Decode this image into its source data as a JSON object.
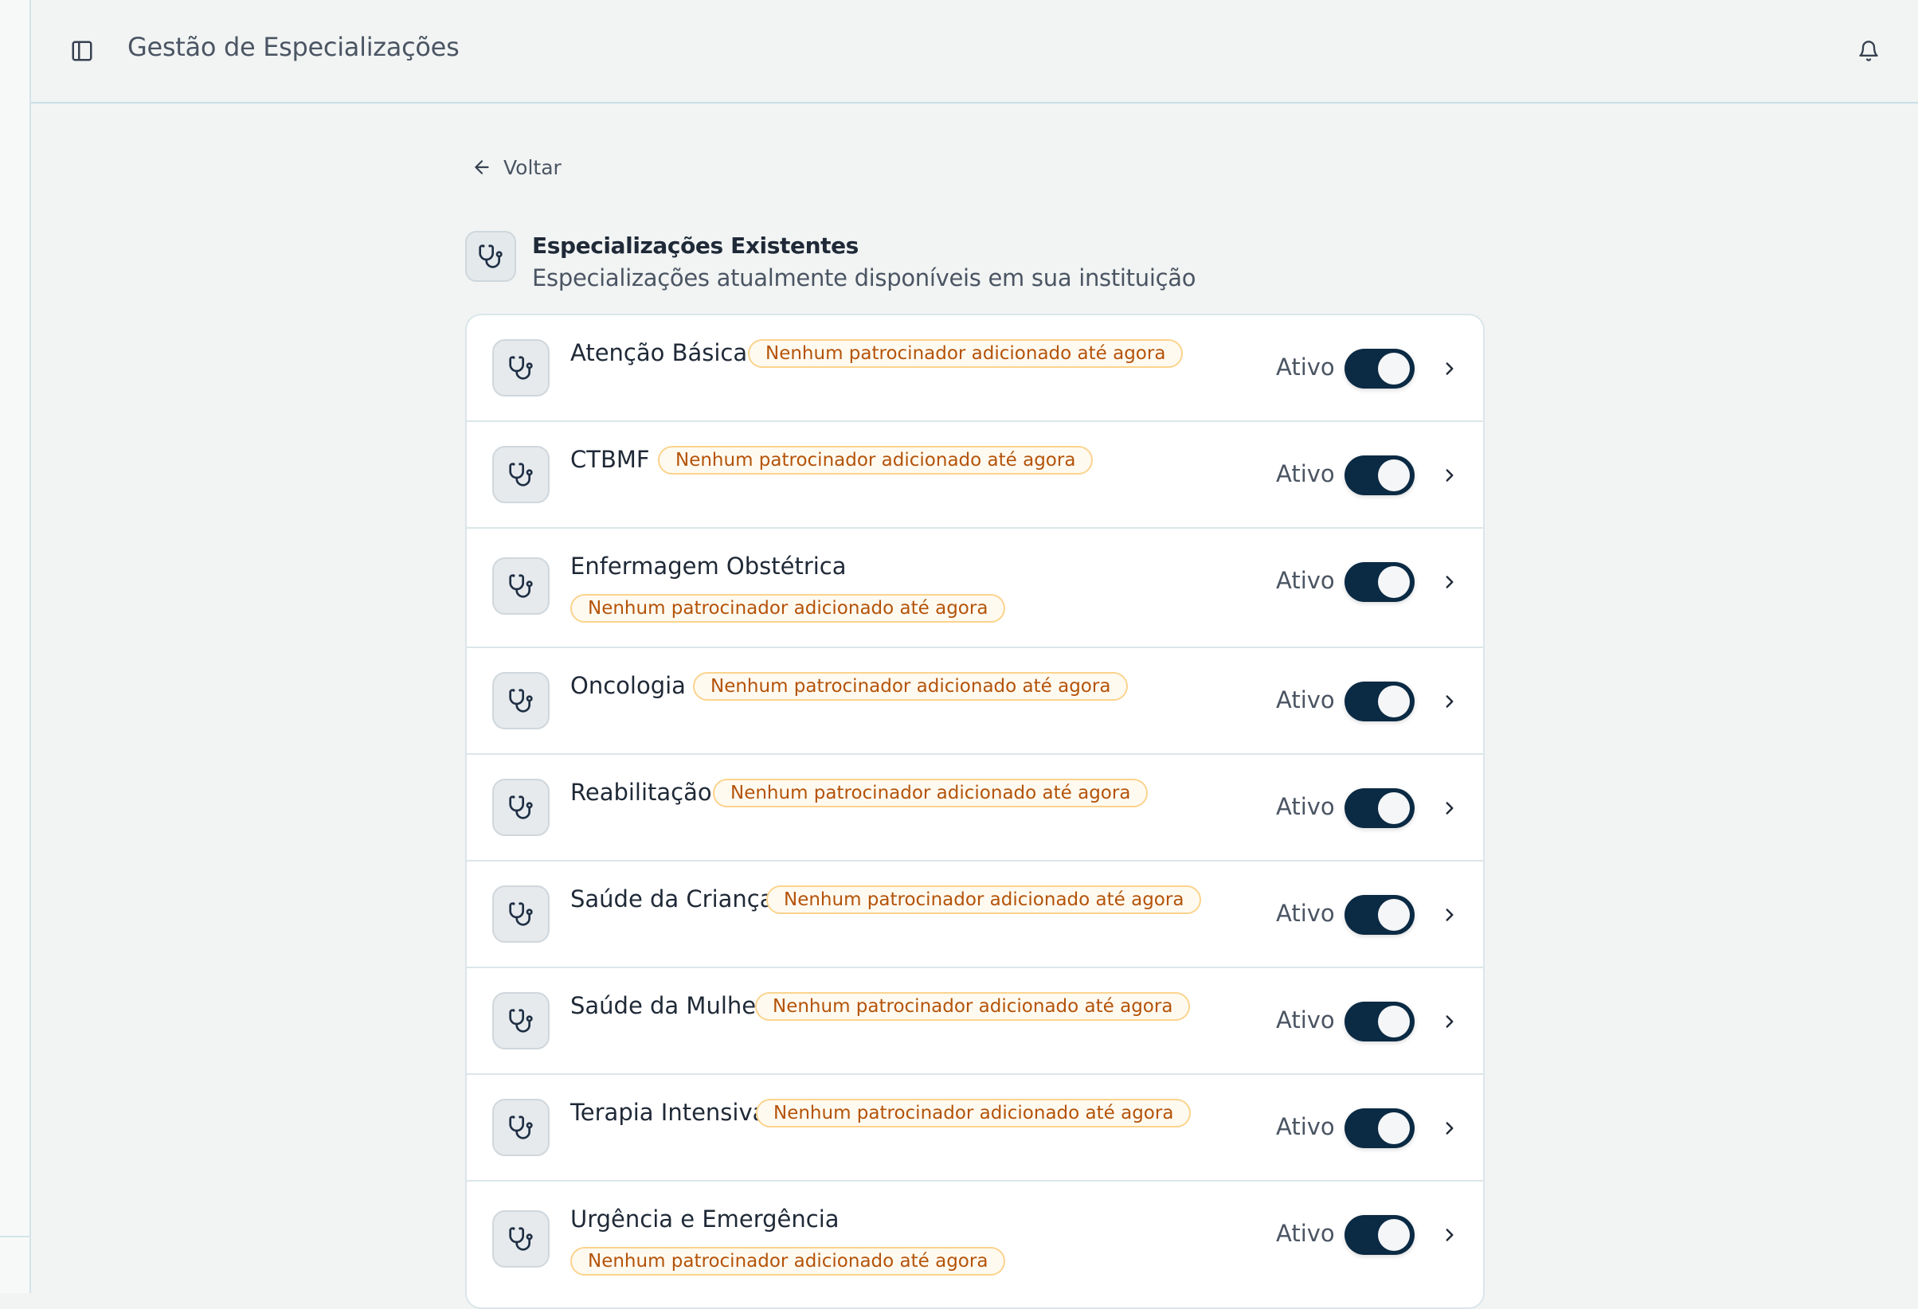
{
  "header": {
    "title": "Gestão de Especializações",
    "sidebar_toggle_icon": "sidebar-panel-icon",
    "notifications_icon": "bell-icon"
  },
  "back": {
    "label": "Voltar",
    "icon": "arrow-left-icon"
  },
  "section": {
    "title": "Especializações Existentes",
    "subtitle": "Especializações atualmente disponíveis em sua instituição",
    "icon": "stethoscope-icon"
  },
  "specializations": [
    {
      "name": "Atenção Básica",
      "badge": "Nenhum patrocinador adicionado até agora",
      "status": "Ativo",
      "active": true
    },
    {
      "name": "CTBMF",
      "badge": "Nenhum patrocinador adicionado até agora",
      "status": "Ativo",
      "active": true
    },
    {
      "name": "Enfermagem Obstétrica",
      "badge": "Nenhum patrocinador adicionado até agora",
      "status": "Ativo",
      "active": true
    },
    {
      "name": "Oncologia",
      "badge": "Nenhum patrocinador adicionado até agora",
      "status": "Ativo",
      "active": true
    },
    {
      "name": "Reabilitação",
      "badge": "Nenhum patrocinador adicionado até agora",
      "status": "Ativo",
      "active": true
    },
    {
      "name": "Saúde da Criança",
      "badge": "Nenhum patrocinador adicionado até agora",
      "status": "Ativo",
      "active": true
    },
    {
      "name": "Saúde da Mulher",
      "badge": "Nenhum patrocinador adicionado até agora",
      "status": "Ativo",
      "active": true
    },
    {
      "name": "Terapia Intensiva",
      "badge": "Nenhum patrocinador adicionado até agora",
      "status": "Ativo",
      "active": true
    },
    {
      "name": "Urgência e Emergência",
      "badge": "Nenhum patrocinador adicionado até agora",
      "status": "Ativo",
      "active": true
    }
  ],
  "colors": {
    "accent_toggle": "#0b2a44",
    "badge_border": "#fbd38d",
    "badge_text": "#b45309",
    "background": "#f1f4f3"
  }
}
